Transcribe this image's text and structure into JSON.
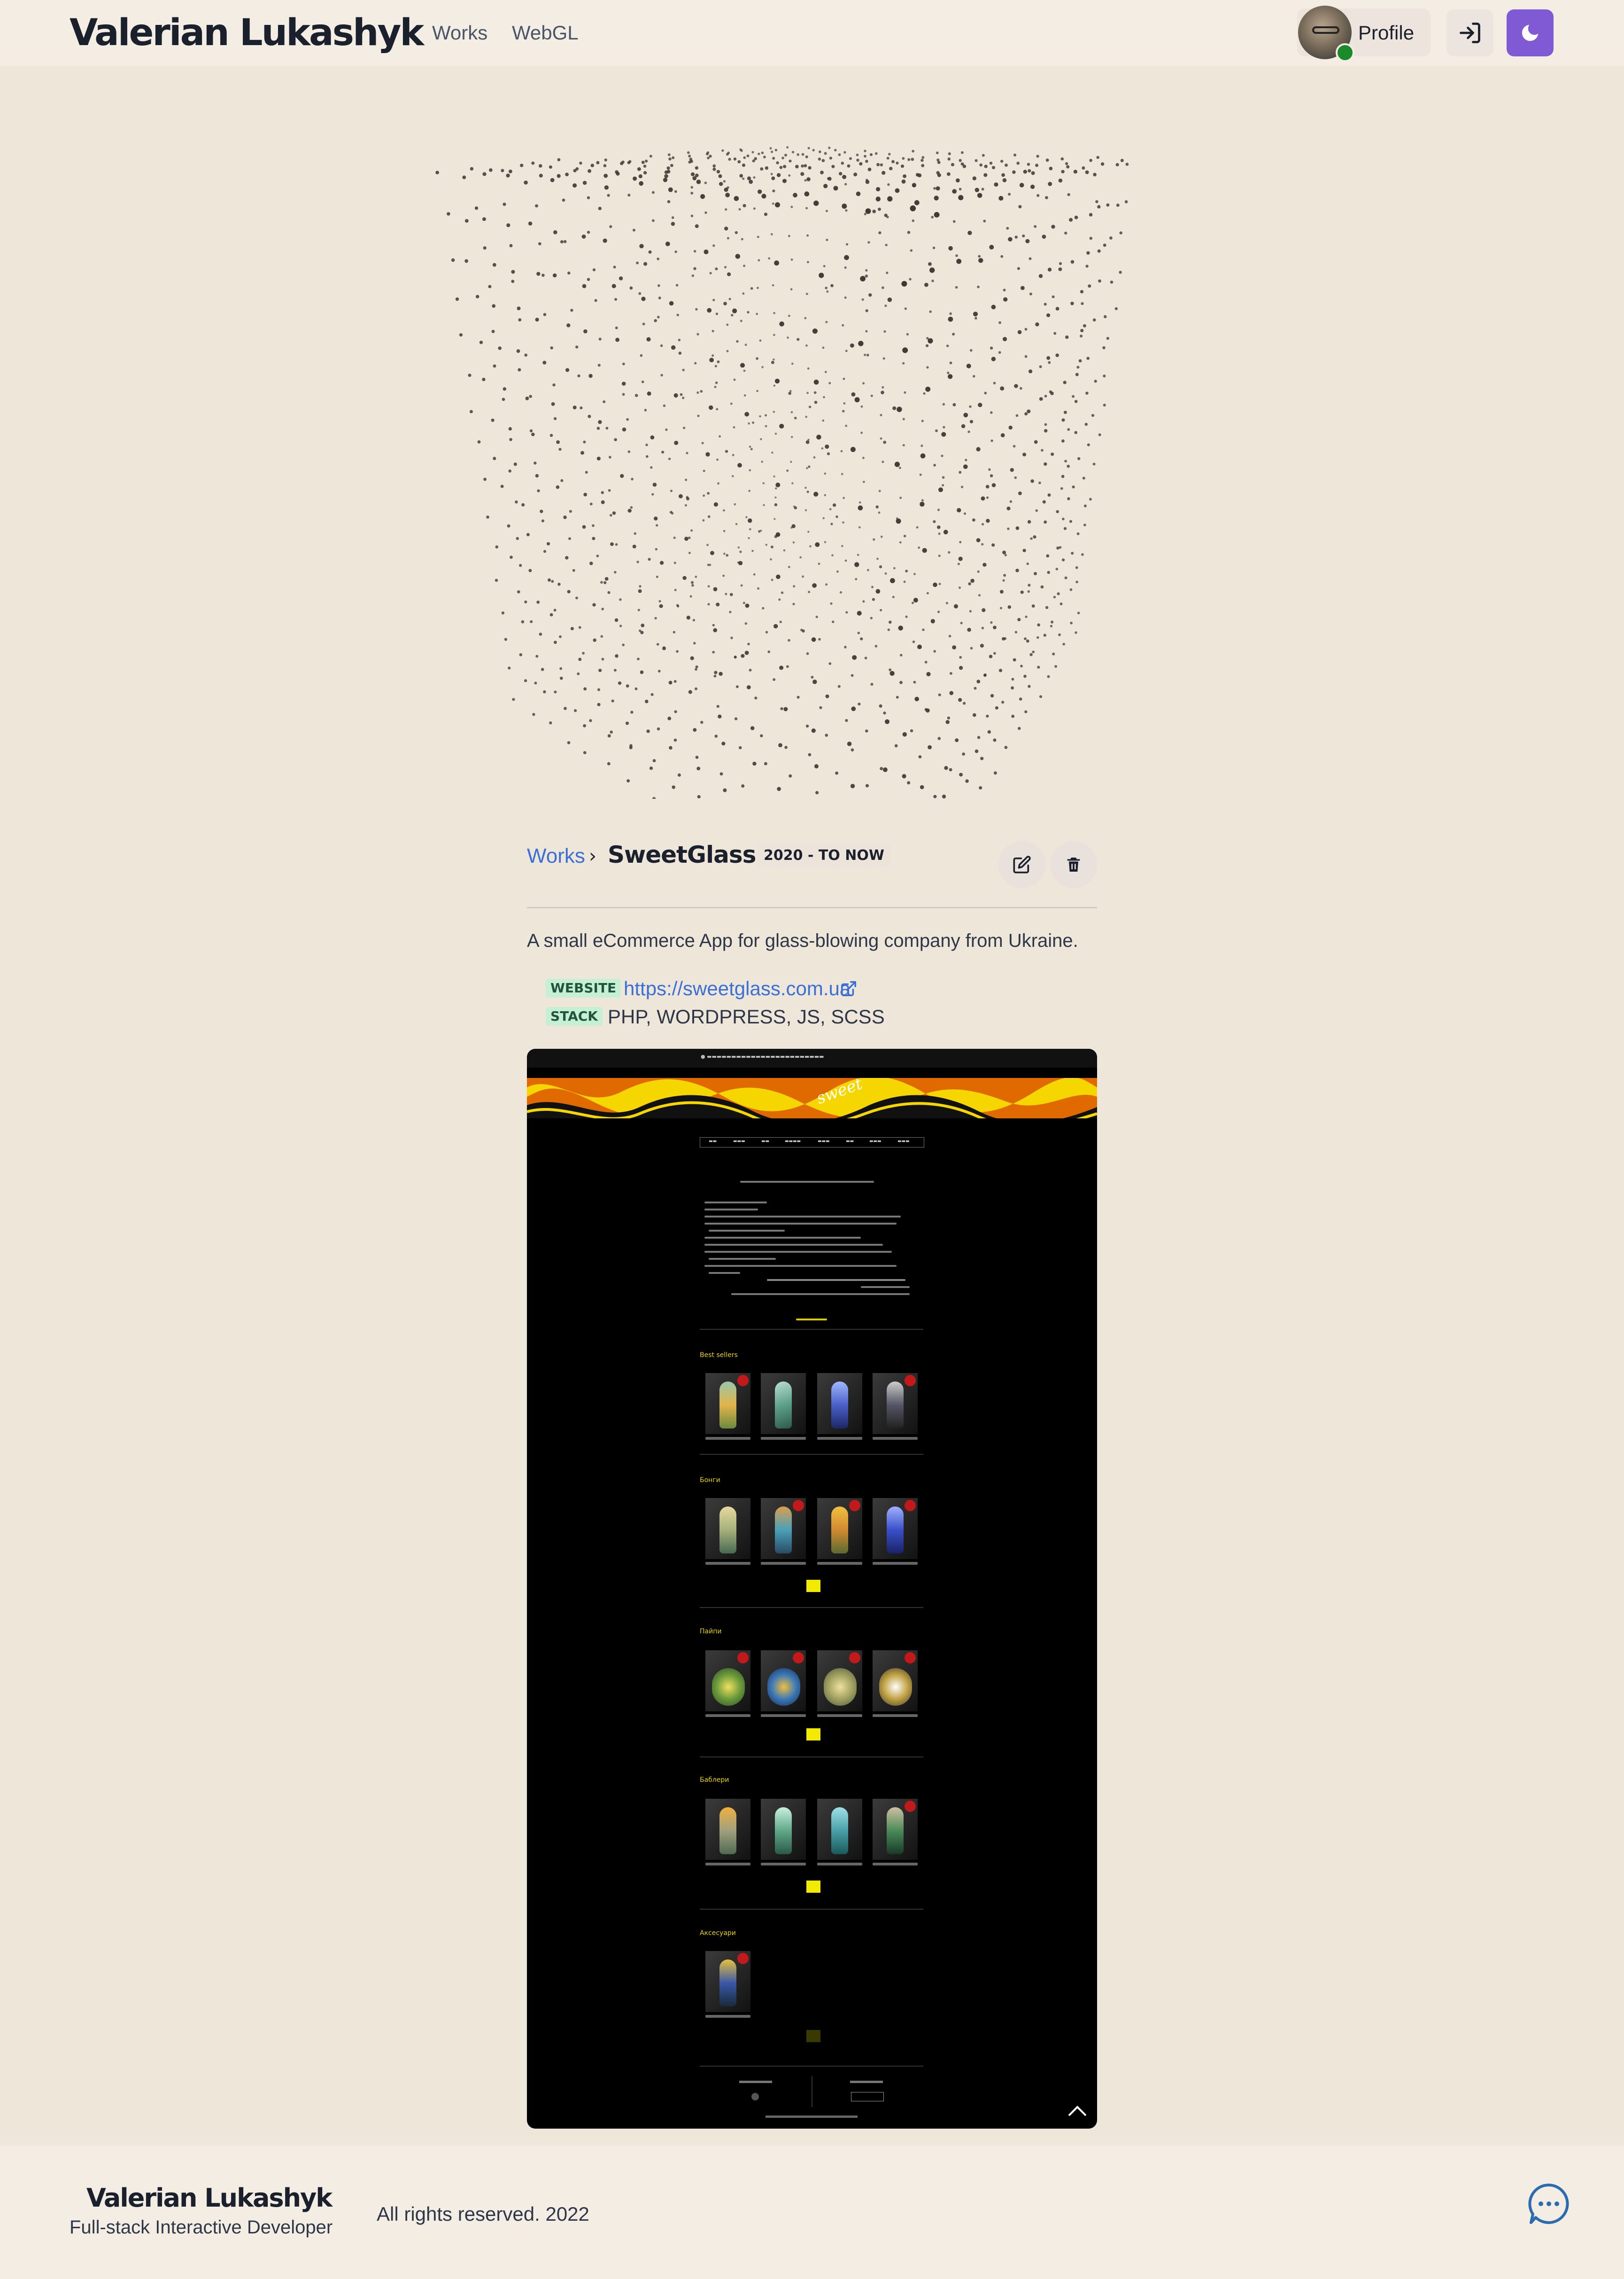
{
  "header": {
    "logo": "Valerian Lukashyk",
    "nav": [
      {
        "label": "Works"
      },
      {
        "label": "WebGL"
      }
    ],
    "profile_label": "Profile",
    "login_icon": "sign-in-icon",
    "theme_icon": "moon-icon",
    "accent_color": "#805ad5"
  },
  "breadcrumb": {
    "parent": "Works",
    "separator": "›",
    "title": "SweetGlass",
    "years": "2020 - TO NOW"
  },
  "actions": {
    "edit_icon": "edit-icon",
    "delete_icon": "trash-icon"
  },
  "description": "A small eCommerce App for glass-blowing company from Ukraine.",
  "meta": {
    "website_tag": "WEBSITE",
    "website_url": "https://sweetglass.com.ua",
    "stack_tag": "STACK",
    "stack_value": "PHP, WORDPRESS, JS, SCSS"
  },
  "screenshot": {
    "sections": [
      "Best sellers",
      "Бонги",
      "Пайпи",
      "Баблери",
      "Аксесуари"
    ]
  },
  "footer": {
    "name": "Valerian Lukashyk",
    "role": "Full-stack Interactive Developer",
    "rights": "All rights reserved. 2022",
    "chat_icon": "chat-icon"
  }
}
